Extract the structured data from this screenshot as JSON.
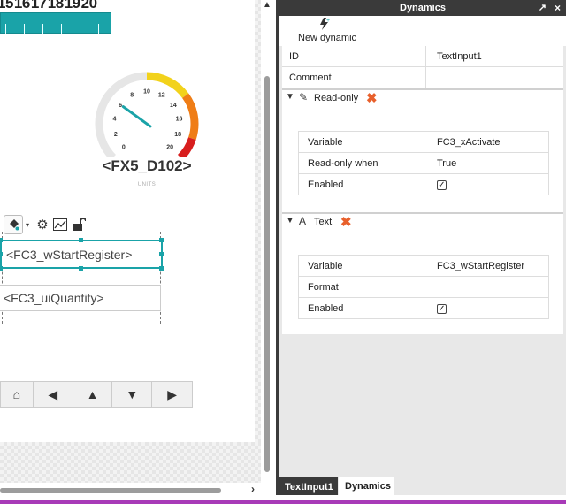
{
  "canvas": {
    "ruler_numbers": [
      "15",
      "16",
      "17",
      "18",
      "19",
      "20"
    ],
    "gauge": {
      "scale_labels": [
        "0",
        "2",
        "4",
        "6",
        "8",
        "10",
        "12",
        "14",
        "16",
        "18",
        "20"
      ],
      "tag": "<FX5_D102>",
      "units": "UNITS",
      "needle_value": 6,
      "range": [
        0,
        20
      ],
      "bands": [
        {
          "from": 0,
          "to": 10,
          "color": "#e6e6e6"
        },
        {
          "from": 10,
          "to": 14,
          "color": "#f2d21b"
        },
        {
          "from": 14,
          "to": 18,
          "color": "#ef7d16"
        },
        {
          "from": 18,
          "to": 20,
          "color": "#d81e1e"
        }
      ],
      "needle_color": "#1aa3a8"
    },
    "mini_toolbar": {
      "paint_icon": "paint-bucket-icon",
      "dropdown_icon": "chevron-down-icon",
      "gear_icon": "gear-icon",
      "trend_icon": "trend-chart-icon",
      "lock_icon": "unlock-icon"
    },
    "input1_text": "<FC3_wStartRegister>",
    "input2_text": "<FC3_uiQuantity>",
    "nav_buttons": [
      {
        "name": "home",
        "glyph": "⌂"
      },
      {
        "name": "left",
        "glyph": "◀"
      },
      {
        "name": "up",
        "glyph": "▲"
      },
      {
        "name": "down",
        "glyph": "▼"
      },
      {
        "name": "right",
        "glyph": "▶"
      }
    ]
  },
  "panel": {
    "title": "Dynamics",
    "undock_glyph": "↗",
    "close_glyph": "×",
    "new_dynamic_label": "New dynamic",
    "rows": [
      {
        "key": "ID",
        "value": "TextInput1"
      },
      {
        "key": "Comment",
        "value": ""
      }
    ],
    "sections": [
      {
        "label": "Read-only",
        "icon": "magic-wand-icon",
        "rows": [
          {
            "key": "Variable",
            "value": "FC3_xActivate"
          },
          {
            "key": "Read-only when",
            "value": "True"
          },
          {
            "key": "Enabled",
            "checked": true
          }
        ]
      },
      {
        "label": "Text",
        "icon": "text-icon",
        "rows": [
          {
            "key": "Variable",
            "value": "FC3_wStartRegister"
          },
          {
            "key": "Format",
            "value": ""
          },
          {
            "key": "Enabled",
            "checked": true
          }
        ]
      }
    ],
    "tabs": [
      "TextInput1",
      "Dynamics"
    ]
  },
  "colors": {
    "accent": "#1aa3a8",
    "panel_dark": "#3a3a3a",
    "delete": "#e8602c",
    "bottom_accent": "#a83ab8"
  }
}
